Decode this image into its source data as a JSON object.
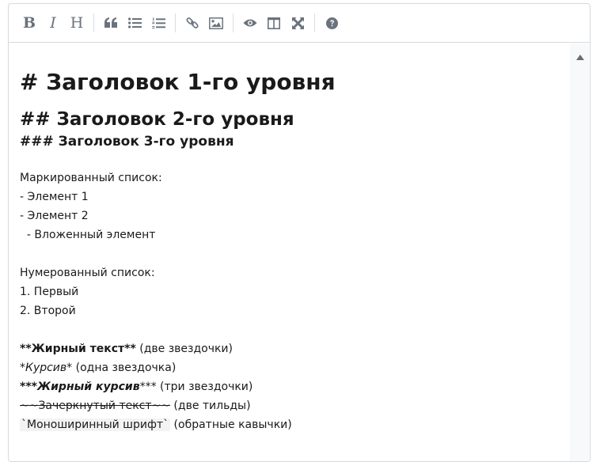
{
  "toolbar": {
    "buttons": [
      {
        "name": "bold",
        "glyph": "B"
      },
      {
        "name": "italic",
        "glyph": "I"
      },
      {
        "name": "heading",
        "glyph": "H"
      },
      {
        "name": "quote",
        "icon": "quote-icon"
      },
      {
        "name": "unordered-list",
        "icon": "list-ul-icon"
      },
      {
        "name": "ordered-list",
        "icon": "list-ol-icon"
      },
      {
        "name": "link",
        "icon": "link-icon"
      },
      {
        "name": "image",
        "icon": "image-icon"
      },
      {
        "name": "preview",
        "icon": "eye-icon"
      },
      {
        "name": "side-by-side",
        "icon": "columns-icon"
      },
      {
        "name": "fullscreen",
        "icon": "arrows-alt-icon"
      },
      {
        "name": "guide",
        "icon": "question-circle-icon"
      }
    ]
  },
  "editor": {
    "h1": "# Заголовок 1-го уровня",
    "h2": "## Заголовок 2-го уровня",
    "h3": "### Заголовок 3-го уровня",
    "bullet_title": "Маркированный список:",
    "bullet_1": "- Элемент 1",
    "bullet_2": "- Элемент 2",
    "bullet_nested": "  - Вложенный элемент",
    "numbered_title": "Нумерованный список:",
    "numbered_1": "1. Первый",
    "numbered_2": "2. Второй",
    "bold_marker": "**Жирный текст**",
    "bold_note": " (две звездочки)",
    "italic_marker": "*Курсив*",
    "italic_note": " (одна звездочка)",
    "bolditalic_open": "***",
    "bolditalic_word": "Жирный курсив",
    "bolditalic_close": "***",
    "bolditalic_note": " (три звездочки)",
    "strike_marker": "~~Зачеркнутый текст~~",
    "strike_note": " (две тильды)",
    "mono_marker": "`Моноширинный шрифт`",
    "mono_note": " (обратные кавычки)"
  }
}
